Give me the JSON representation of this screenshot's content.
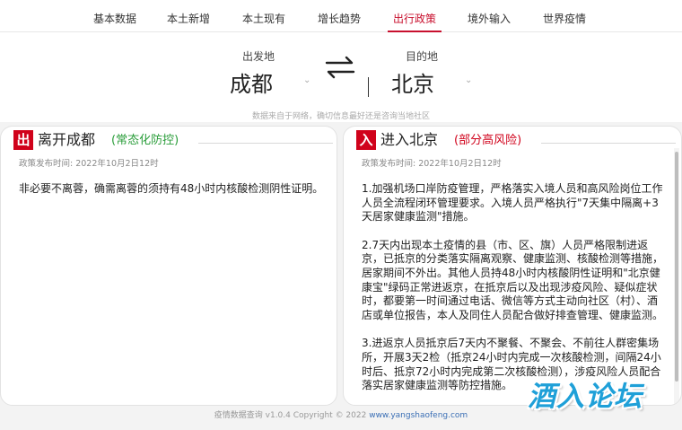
{
  "nav": {
    "items": [
      {
        "label": "基本数据",
        "active": false
      },
      {
        "label": "本土新增",
        "active": false
      },
      {
        "label": "本土现有",
        "active": false
      },
      {
        "label": "增长趋势",
        "active": false
      },
      {
        "label": "出行政策",
        "active": true
      },
      {
        "label": "境外输入",
        "active": false
      },
      {
        "label": "世界疫情",
        "active": false
      }
    ]
  },
  "route": {
    "from_label": "出发地",
    "from_city": "成都",
    "to_label": "目的地",
    "to_city": "北京",
    "source_note": "数据来自于网络，确切信息最好还是咨询当地社区"
  },
  "leave_panel": {
    "badge": "出",
    "title": "离开成都",
    "risk": "(常态化防控)",
    "risk_color": "#2a9d3a",
    "publish_time": "政策发布时间: 2022年10月2日12时",
    "paragraphs": [
      "非必要不离蓉，确需离蓉的须持有48小时内核酸检测阴性证明。"
    ]
  },
  "enter_panel": {
    "badge": "入",
    "title": "进入北京",
    "risk": "(部分高风险)",
    "risk_color": "#d0021b",
    "publish_time": "政策发布时间: 2022年10月2日12时",
    "paragraphs": [
      "1.加强机场口岸防疫管理，严格落实入境人员和高风险岗位工作人员全流程闭环管理要求。入境人员严格执行\"7天集中隔离+3天居家健康监测\"措施。",
      "2.7天内出现本土疫情的县（市、区、旗）人员严格限制进返京，已抵京的分类落实隔离观察、健康监测、核酸检测等措施，居家期间不外出。其他人员持48小时内核酸阴性证明和\"北京健康宝\"绿码正常进返京，在抵京后以及出现涉疫风险、疑似症状时，都要第一时间通过电话、微信等方式主动向社区（村）、酒店或单位报告，本人及同住人员配合做好排查管理、健康监测。",
      "3.进返京人员抵京后7天内不聚餐、不聚会、不前往人群密集场所，开展3天2检（抵京24小时内完成一次核酸检测，间隔24小时后、抵京72小时内完成第二次核酸检测），涉疫风险人员配合落实居家健康监测等防控措施。"
    ]
  },
  "footer": {
    "prefix": "疫情数据查询 v1.0.4 Copyright © 2022 ",
    "link": "www.yangshaofeng.com"
  },
  "watermark": "酒入论坛",
  "colors": {
    "accent": "#c8102e",
    "badge": "#d0021b",
    "link": "#3b6fb5"
  }
}
